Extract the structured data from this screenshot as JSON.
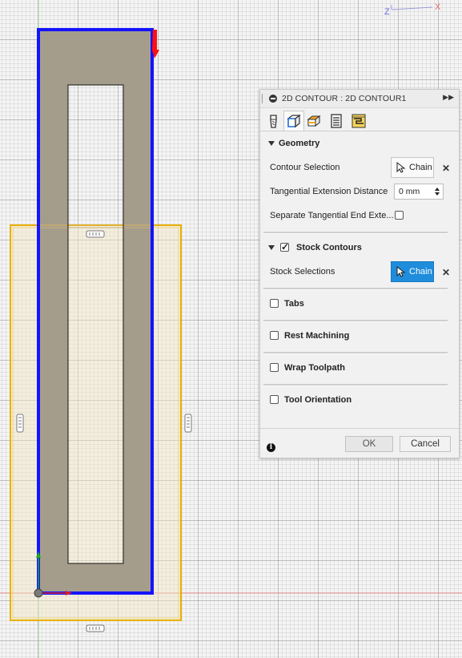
{
  "viewcube": {
    "z_label": "Z",
    "x_label": "X"
  },
  "panel": {
    "title": "2D CONTOUR : 2D CONTOUR1",
    "tabs": [
      "tool-tab",
      "geometry-tab",
      "heights-tab",
      "passes-tab",
      "linking-tab"
    ],
    "geometry": {
      "header": "Geometry",
      "contour_selection_label": "Contour Selection",
      "contour_selection_button": "Chain",
      "tangential_extension_label": "Tangential Extension Distance",
      "tangential_extension_value": "0 mm",
      "separate_tangential_label": "Separate Tangential End Exte..."
    },
    "stock_contours": {
      "header": "Stock Contours",
      "checked": true,
      "stock_selections_label": "Stock Selections",
      "stock_selections_button": "Chain"
    },
    "sections": {
      "tabs": "Tabs",
      "rest_machining": "Rest Machining",
      "wrap_toolpath": "Wrap Toolpath",
      "tool_orientation": "Tool Orientation"
    },
    "ok_label": "OK",
    "cancel_label": "Cancel"
  },
  "colors": {
    "contour_blue": "#1414ff",
    "stock_orange": "#e8b000",
    "part_fill": "#a59d8c",
    "active_button": "#1f8ddc"
  }
}
